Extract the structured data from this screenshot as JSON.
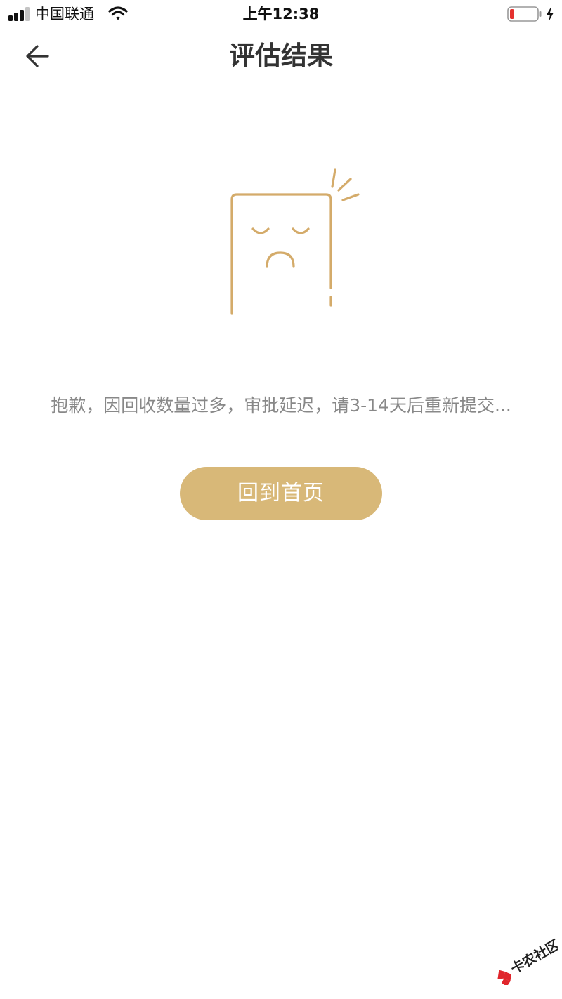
{
  "colors": {
    "accent": "#D8B878",
    "illustration": "#D4AB6A",
    "title_text": "#333333",
    "message_text": "#888888",
    "watermark_red": "#E0262C"
  },
  "status_bar": {
    "carrier": "中国联通",
    "time": "上午12:38",
    "signal_bars_filled": 3,
    "signal_bars_total": 4,
    "battery_level": 0.15,
    "charging": true
  },
  "nav": {
    "back_icon": "arrow-left-icon",
    "title": "评估结果"
  },
  "illustration": {
    "icon": "sad-card-icon"
  },
  "message": "抱歉，因回收数量过多，审批延迟，请3-14天后重新提交...",
  "home_button": {
    "label": "回到首页"
  },
  "watermark": {
    "text": "卡农社区"
  }
}
